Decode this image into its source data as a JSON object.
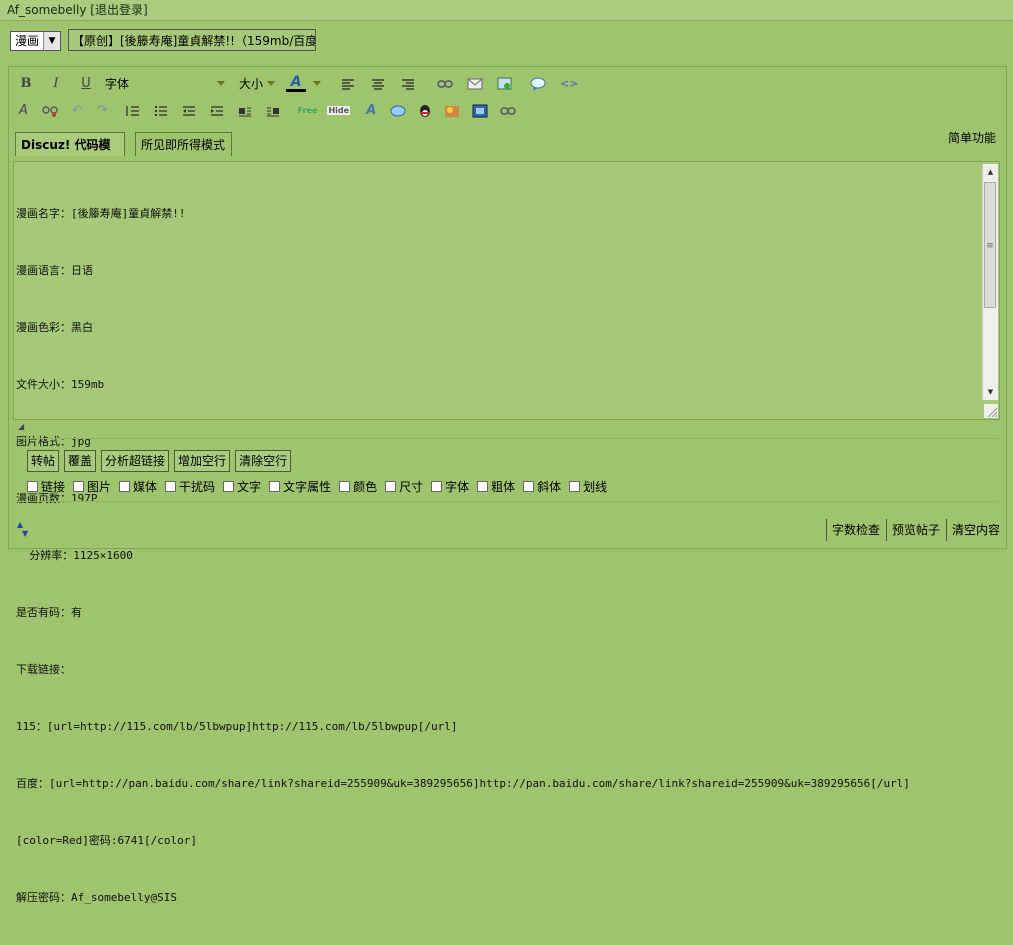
{
  "header": {
    "user_label": "Af_somebelly [退出登录]"
  },
  "post": {
    "type_value": "漫画",
    "title_value": "【原创】[後籐寿庵]童貞解禁!!（159mb/百度$"
  },
  "toolbar": {
    "font_label": "字体",
    "size_label": "大小",
    "free_label": "Free",
    "hide_label": "Hide"
  },
  "modes": {
    "code_mode": "Discuz! 代码模式",
    "wysiwyg_mode": "所见即所得模式",
    "simple_fn": "简单功能"
  },
  "content_lines": [
    "漫画名字：[後籐寿庵]童貞解禁!!",
    "漫画语言：日语",
    "漫画色彩：黑白",
    "文件大小：159mb",
    "图片格式：jpg",
    "漫画页数：197P",
    "  分辨率：1125×1600",
    "是否有码：有",
    "下载链接：",
    "115：[url=http://115.com/lb/5lbwpup]http://115.com/lb/5lbwpup[/url]",
    "百度：[url=http://pan.baidu.com/share/link?shareid=255909&uk=389295656]http://pan.baidu.com/share/link?shareid=255909&uk=389295656[/url]",
    "[color=Red]密码:6741[/color]",
    "解压密码：Af_somebelly@SIS"
  ],
  "actions": {
    "buttons": [
      "转帖",
      "覆盖",
      "分析超链接",
      "增加空行",
      "清除空行"
    ],
    "checkboxes": [
      "链接",
      "图片",
      "媒体",
      "干扰码",
      "文字",
      "文字属性",
      "颜色",
      "尺寸",
      "字体",
      "粗体",
      "斜体",
      "划线"
    ]
  },
  "footer": {
    "check_label": "字数检查",
    "preview_label": "预览帖子",
    "clear_label": "清空内容"
  }
}
